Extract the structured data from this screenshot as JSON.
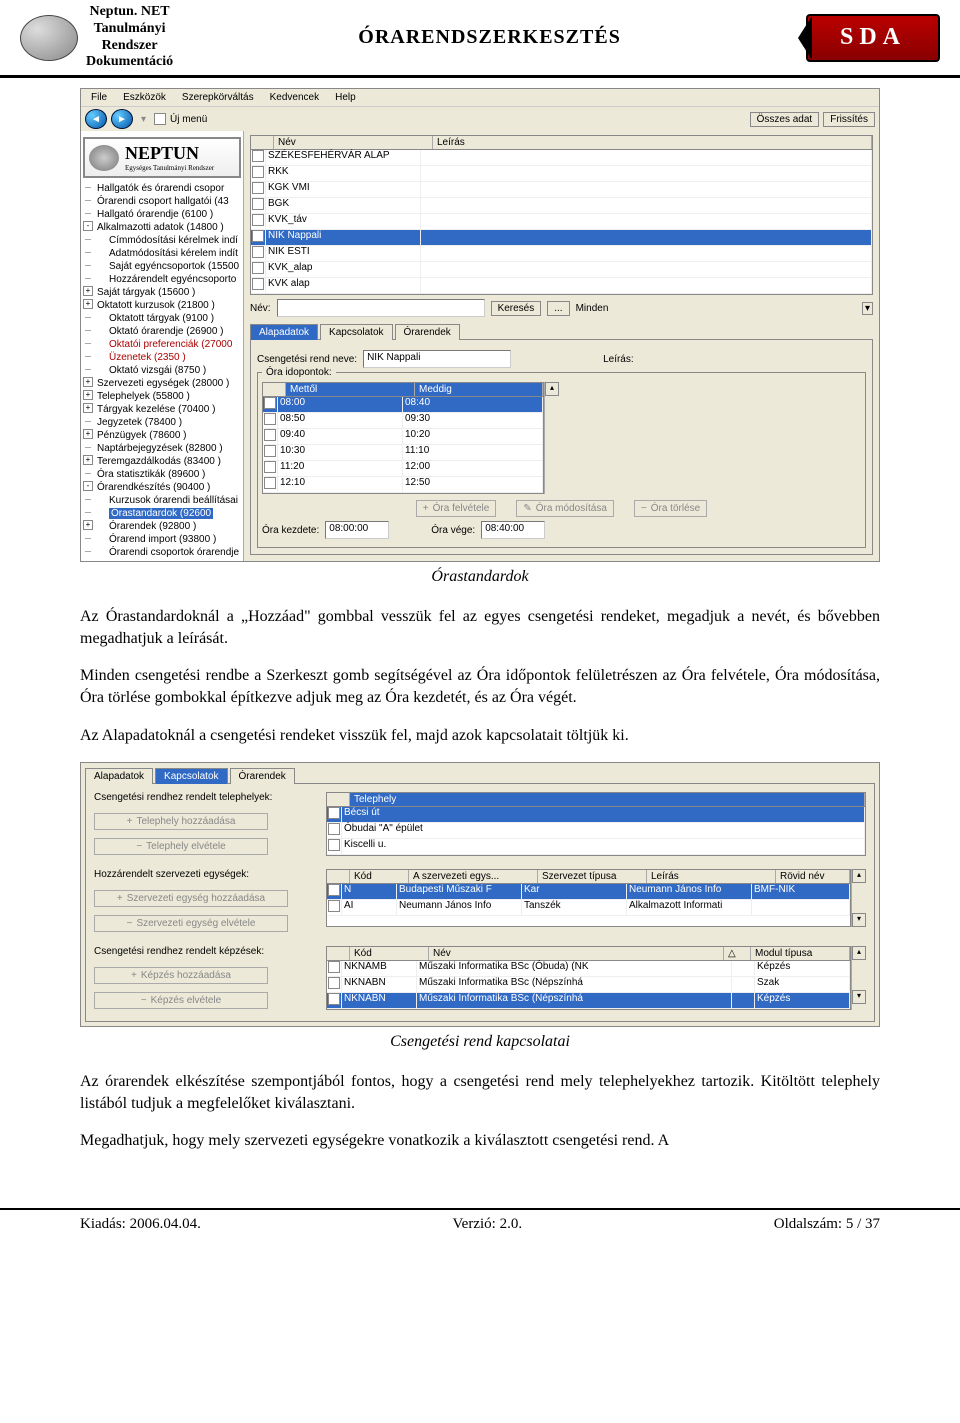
{
  "header": {
    "left_line1": "Neptun. NET",
    "left_line2": "Tanulmányi",
    "left_line3": "Rendszer",
    "left_line4": "Dokumentáció",
    "center": "ÓRARENDSZERKESZTÉS",
    "sda": "SDA"
  },
  "screenshot1": {
    "menu": [
      "File",
      "Eszközök",
      "Szerepkörváltás",
      "Kedvencek",
      "Help"
    ],
    "uj_menu": "Új menü",
    "osszes_adat": "Összes adat",
    "frissites": "Frissítés",
    "neptun_brand": "NEPTUN",
    "neptun_sub": "Egységes Tanulmányi Rendszer",
    "tree": [
      "Hallgatók és órarendi csopor",
      "Órarendi csoport hallgatói (43",
      "Hallgató órarendje (6100  )",
      "Alkalmazotti adatok (14800  )",
      "Címmódosítási kérelmek indí",
      "Adatmódosítási kérelem indít",
      "Saját egyéncsoportok (15500",
      "Hozzárendelt egyéncsoporto",
      "Saját tárgyak (15600  )",
      "Oktatott kurzusok (21800  )",
      "Oktatott tárgyak (9100  )",
      "Oktató órarendje (26900  )",
      "Oktatói preferenciák (27000",
      "Üzenetek (2350  )",
      "Oktató vizsgái (8750  )",
      "Szervezeti egységek (28000  )",
      "Telephelyek (55800  )",
      "Tárgyak kezelése (70400  )",
      "Jegyzetek (78400  )",
      "Pénzügyek (78600  )",
      "Naptárbejegyzések (82800  )",
      "Teremgazdálkodás (83400  )",
      "Óra statisztikák (89600  )",
      "Órarendkészítés (90400  )",
      "Kurzusok órarendi beállításai",
      "Órastandardok (92600",
      "Órarendek (92800  )",
      "Órarend import (93800  )",
      "Órarendi csoportok órarendje"
    ],
    "grid1_headers": [
      "Név",
      "Leírás"
    ],
    "grid1_rows": [
      "SZÉKESFEHÉRVÁR ALAP",
      "RKK",
      "KGK VMI",
      "BGK",
      "KVK_táv",
      "NIK Nappali",
      "NIK ESTI",
      "KVK_alap",
      "KVK  alap"
    ],
    "nev_label": "Név:",
    "kereses": "Keresés",
    "dots": "...",
    "minden": "Minden",
    "tabs": [
      "Alapadatok",
      "Kapcsolatok",
      "Órarendek"
    ],
    "csengetesi_label": "Csengetési rend neve:",
    "csengetesi_value": "NIK Nappali",
    "leiras_label": "Leírás:",
    "ora_idopontok": "Óra idopontok:",
    "time_headers": [
      "Mettől",
      "Meddig"
    ],
    "time_rows": [
      [
        "08:00",
        "08:40"
      ],
      [
        "08:50",
        "09:30"
      ],
      [
        "09:40",
        "10:20"
      ],
      [
        "10:30",
        "11:10"
      ],
      [
        "11:20",
        "12:00"
      ],
      [
        "12:10",
        "12:50"
      ]
    ],
    "btn_felvetele": "Óra felvétele",
    "btn_modositasa": "Óra módosítása",
    "btn_torlese": "Óra törlése",
    "kezdete_label": "Óra kezdete:",
    "kezdete_val": "08:00:00",
    "vege_label": "Óra vége:",
    "vege_val": "08:40:00"
  },
  "caption1": "Órastandardok",
  "para1": "Az Órastandardoknál a „Hozzáad\" gombbal vesszük fel az egyes csengetési rendeket, megadjuk a nevét, és bővebben megadhatjuk a leírását.",
  "para2": "Minden csengetési rendbe a Szerkeszt gomb segítségével az Óra időpontok felületrészen az Óra felvétele, Óra módosítása, Óra törlése gombokkal építkezve adjuk meg az Óra kezdetét, és az Óra végét.",
  "para3": "Az Alapadatoknál a csengetési rendeket visszük fel, majd azok kapcsolatait töltjük ki.",
  "screenshot2": {
    "tabs": [
      "Alapadatok",
      "Kapcsolatok",
      "Órarendek"
    ],
    "telephely_label": "Csengetési rendhez rendelt telephelyek:",
    "telephely_header": "Telephely",
    "telephely_rows": [
      "Bécsi út",
      "Óbudai \"A\" épület",
      "Kiscelli u."
    ],
    "btn_telep_add": "Telephely hozzáadása",
    "btn_telep_del": "Telephely elvétele",
    "szerv_label": "Hozzárendelt szervezeti egységek:",
    "szerv_headers": [
      "Kód",
      "A szervezeti egys...",
      "Szervezet típusa",
      "Leírás",
      "Rövid név"
    ],
    "szerv_rows": [
      [
        "N",
        "Budapesti Műszaki F",
        "Kar",
        "Neumann János Info",
        "BMF-NIK"
      ],
      [
        "AI",
        "Neumann János Info",
        "Tanszék",
        "Alkalmazott Informati",
        ""
      ]
    ],
    "btn_szerv_add": "Szervezeti egység hozzáadása",
    "btn_szerv_del": "Szervezeti egység elvétele",
    "kepzes_label": "Csengetési rendhez rendelt képzések:",
    "kepzes_headers": [
      "Kód",
      "Név",
      "△",
      "Modul típusa"
    ],
    "kepzes_rows": [
      [
        "NKNAMB",
        "Műszaki Informatika BSc (Óbuda) (NK",
        "Képzés"
      ],
      [
        "NKNABN",
        "Műszaki Informatika BSc (Népszínhá",
        "Szak"
      ],
      [
        "NKNABN",
        "Műszaki Informatika BSc (Népszínhá",
        "Képzés"
      ]
    ],
    "btn_kepzes_add": "Képzés hozzáadása",
    "btn_kepzes_del": "Képzés elvétele"
  },
  "caption2": "Csengetési rend kapcsolatai",
  "para4": "Az órarendek elkészítése szempontjából fontos, hogy a csengetési rend mely telephelyekhez tartozik. Kitöltött telephely listából tudjuk a megfelelőket kiválasztani.",
  "para5": "Megadhatjuk, hogy mely szervezeti egységekre vonatkozik a kiválasztott csengetési rend. A",
  "footer": {
    "kiadas": "Kiadás: 2006.04.04.",
    "verzio": "Verzió: 2.0.",
    "oldalszam": "Oldalszám: 5 / 37"
  }
}
